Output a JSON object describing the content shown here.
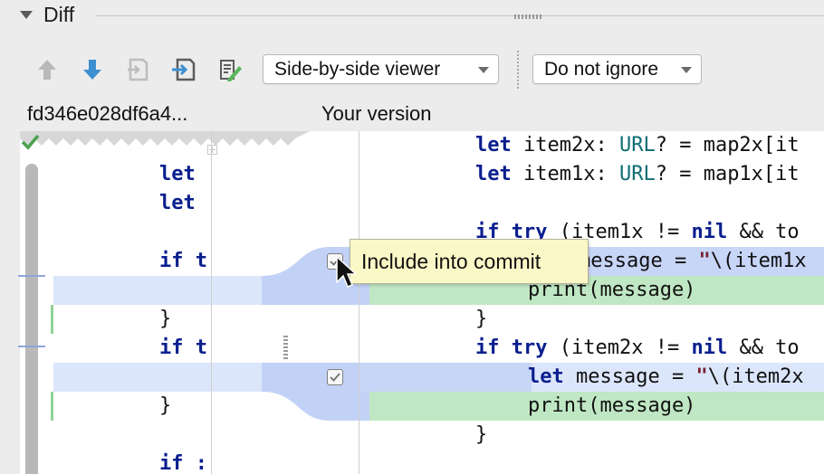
{
  "header": {
    "title": "Diff"
  },
  "toolbar": {
    "viewer_mode": "Side-by-side viewer",
    "whitespace_mode": "Do not ignore",
    "icons": [
      "arrow-up-icon",
      "arrow-down-icon",
      "jump-to-source-icon",
      "open-in-editor-icon",
      "edit-annotate-icon"
    ]
  },
  "columns": {
    "left_label": "fd346e028df6a4...",
    "right_label": "Your version"
  },
  "left_code": [
    "let",
    "let",
    "if t",
    "}",
    "if t",
    "}",
    "if :"
  ],
  "right_code": {
    "l1_kw": "let",
    "l1_a": " item2x: ",
    "l1_type": "URL",
    "l1_b": "? = map2x[it",
    "l2_kw": "let",
    "l2_a": " item1x: ",
    "l2_type": "URL",
    "l2_b": "? = map1x[it",
    "l3_kw1": "if",
    "l3_kw2": "try",
    "l3_a": " (item1x != ",
    "l3_kw3": "nil",
    "l3_b": " && to",
    "l4_a": "message = ",
    "l4_str": "\"",
    "l4_b": "\\(item1x",
    "l5": "print(message)",
    "l6": "}",
    "l7_kw1": "if",
    "l7_kw2": "try",
    "l7_a": " (item2x != ",
    "l7_kw3": "nil",
    "l7_b": " && to",
    "l8_kw": "let",
    "l8_a": " message = ",
    "l8_str": "\"",
    "l8_b": "\\(item2x",
    "l9": "print(message)",
    "l10": "}"
  },
  "tooltip": {
    "text": "Include into commit"
  },
  "colors": {
    "inserted_bg": "#bfe7c3",
    "changed_bg": "#dce6fb",
    "keyword": "#0a1f8e",
    "type": "#0f6d73"
  }
}
